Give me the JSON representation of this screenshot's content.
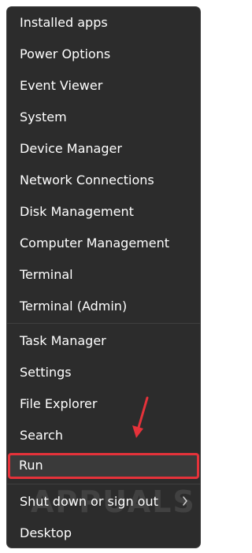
{
  "menu": {
    "group1": [
      {
        "label": "Installed apps"
      },
      {
        "label": "Power Options"
      },
      {
        "label": "Event Viewer"
      },
      {
        "label": "System"
      },
      {
        "label": "Device Manager"
      },
      {
        "label": "Network Connections"
      },
      {
        "label": "Disk Management"
      },
      {
        "label": "Computer Management"
      },
      {
        "label": "Terminal"
      },
      {
        "label": "Terminal (Admin)"
      }
    ],
    "group2": [
      {
        "label": "Task Manager"
      },
      {
        "label": "Settings"
      },
      {
        "label": "File Explorer"
      },
      {
        "label": "Search"
      },
      {
        "label": "Run"
      }
    ],
    "group3": [
      {
        "label": "Shut down or sign out",
        "submenu": true
      },
      {
        "label": "Desktop"
      }
    ]
  },
  "annotation": {
    "highlighted_item": "Run",
    "highlight_color": "#e5323a",
    "arrow_color": "#e5323a"
  },
  "watermark": {
    "text": "APPUALS"
  },
  "colors": {
    "menu_background": "#2c2c2c",
    "text": "#ffffff",
    "separator": "#3f3f3f"
  }
}
